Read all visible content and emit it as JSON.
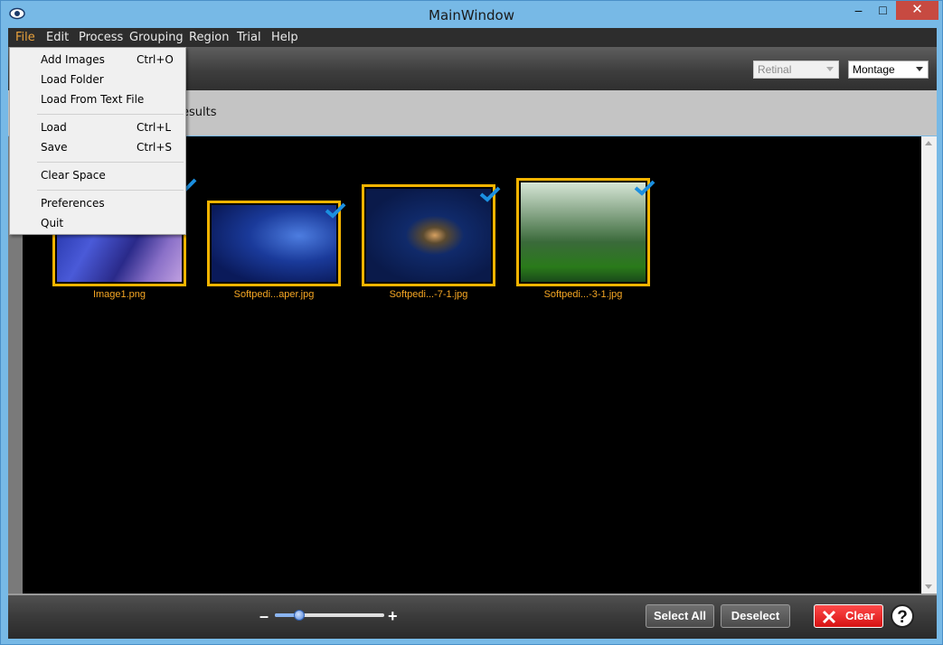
{
  "window": {
    "title": "MainWindow",
    "minimize": "–",
    "maximize": "□",
    "close": "✕"
  },
  "menubar": {
    "items": [
      "File",
      "Edit",
      "Process",
      "Grouping",
      "Region",
      "Trial",
      "Help"
    ]
  },
  "toolbar": {
    "combo1": {
      "value": "Retinal",
      "disabled": true
    },
    "combo2": {
      "value": "Montage",
      "disabled": false
    }
  },
  "tabs": {
    "results_partial": "esults"
  },
  "file_menu": {
    "items": [
      {
        "label": "Add Images",
        "shortcut": "Ctrl+O"
      },
      {
        "label": "Load Folder",
        "shortcut": ""
      },
      {
        "label": "Load From Text File",
        "shortcut": ""
      },
      {
        "label": "Load",
        "shortcut": "Ctrl+L"
      },
      {
        "label": "Save",
        "shortcut": "Ctrl+S"
      },
      {
        "label": "Clear Space",
        "shortcut": ""
      },
      {
        "label": "Preferences",
        "shortcut": ""
      },
      {
        "label": "Quit",
        "shortcut": ""
      }
    ]
  },
  "thumbnails": [
    {
      "caption": "Image1.png",
      "selected": true
    },
    {
      "caption": "Softpedi...aper.jpg",
      "selected": true
    },
    {
      "caption": "Softpedi...-7-1.jpg",
      "selected": true
    },
    {
      "caption": "Softpedi...-3-1.jpg",
      "selected": true
    }
  ],
  "bottombar": {
    "zoom_minus": "–",
    "zoom_plus": "+",
    "zoom_level": 0.2,
    "select_all": "Select All",
    "deselect": "Deselect",
    "clear": "Clear",
    "help": "?"
  },
  "colors": {
    "accent_orange": "#f5b400",
    "check_blue": "#1b8fe0",
    "clear_red": "#e02020",
    "menubar_bg": "#2d2d2d",
    "titlebar_bg": "#77b9e6"
  }
}
